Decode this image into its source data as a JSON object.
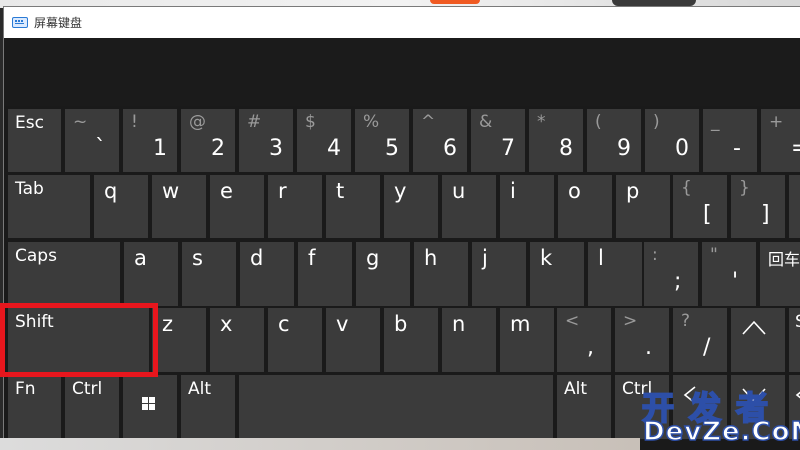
{
  "window": {
    "title": "屏幕键盘",
    "app_icon": "keyboard-icon"
  },
  "keys": {
    "esc": "Esc",
    "num_row": [
      {
        "top": "~",
        "bot": "`"
      },
      {
        "top": "!",
        "bot": "1"
      },
      {
        "top": "@",
        "bot": "2"
      },
      {
        "top": "#",
        "bot": "3"
      },
      {
        "top": "$",
        "bot": "4"
      },
      {
        "top": "%",
        "bot": "5"
      },
      {
        "top": "^",
        "bot": "6"
      },
      {
        "top": "&",
        "bot": "7"
      },
      {
        "top": "*",
        "bot": "8"
      },
      {
        "top": "(",
        "bot": "9"
      },
      {
        "top": ")",
        "bot": "0"
      },
      {
        "top": "_",
        "bot": "-"
      },
      {
        "top": "+",
        "bot": "="
      }
    ],
    "tab": "Tab",
    "qrow": [
      "q",
      "w",
      "e",
      "r",
      "t",
      "y",
      "u",
      "i",
      "o",
      "p"
    ],
    "brackets": [
      {
        "top": "{",
        "bot": "["
      },
      {
        "top": "}",
        "bot": "]"
      }
    ],
    "caps": "Caps",
    "arow": [
      "a",
      "s",
      "d",
      "f",
      "g",
      "h",
      "j",
      "k",
      "l"
    ],
    "semi": {
      "top": ":",
      "bot": ";"
    },
    "quote": {
      "top": "\"",
      "bot": "'"
    },
    "enter": "回车",
    "shift": "Shift",
    "zrow": [
      "z",
      "x",
      "c",
      "v",
      "b",
      "n",
      "m"
    ],
    "comma": {
      "top": "<",
      "bot": ","
    },
    "period": {
      "top": ">",
      "bot": "."
    },
    "slash": {
      "top": "?",
      "bot": "/"
    },
    "up": "^",
    "shift_right_top": "S",
    "fn": "Fn",
    "ctrl": "Ctrl",
    "alt": "Alt",
    "alt_right": "Alt",
    "ctrl_right": "Ctrl",
    "left": "<",
    "down": "v",
    "right": "<"
  },
  "watermark": {
    "cn": "开发者",
    "en": "DevZe.CoM"
  },
  "colors": {
    "key_bg": "#3b3b3b",
    "window_bg": "#1a1a1a",
    "highlight": "#e8161d",
    "watermark_stroke": "#2d4fa8"
  }
}
